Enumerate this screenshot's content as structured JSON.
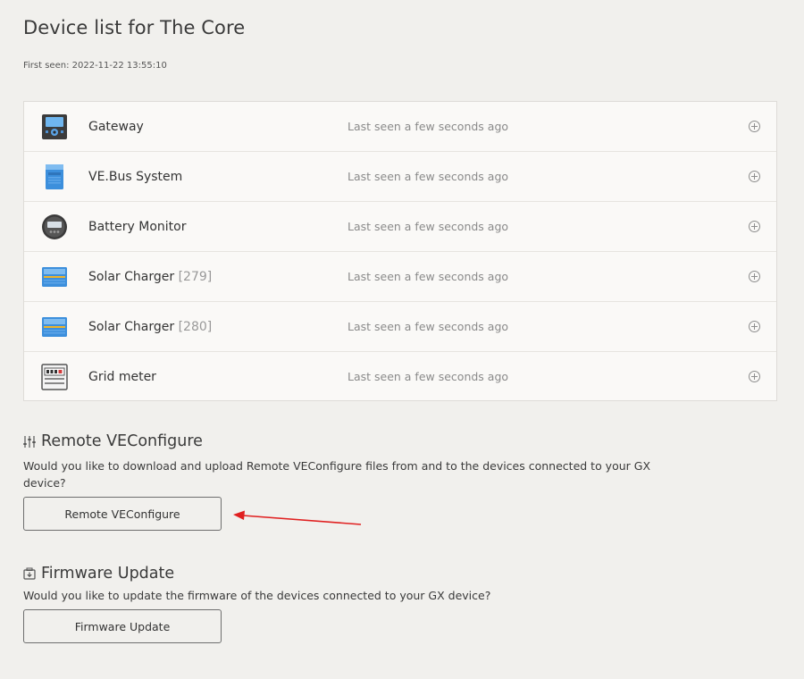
{
  "page": {
    "title": "Device list for The Core",
    "first_seen": "First seen: 2022-11-22 13:55:10"
  },
  "devices": [
    {
      "name": "Gateway",
      "id": "",
      "status": "Last seen a few seconds ago",
      "icon": "gateway-icon"
    },
    {
      "name": "VE.Bus System",
      "id": "",
      "status": "Last seen a few seconds ago",
      "icon": "inverter-icon"
    },
    {
      "name": "Battery Monitor",
      "id": "",
      "status": "Last seen a few seconds ago",
      "icon": "battery-monitor-icon"
    },
    {
      "name": "Solar Charger",
      "id": "[279]",
      "status": "Last seen a few seconds ago",
      "icon": "solar-charger-icon"
    },
    {
      "name": "Solar Charger",
      "id": "[280]",
      "status": "Last seen a few seconds ago",
      "icon": "solar-charger-icon"
    },
    {
      "name": "Grid meter",
      "id": "",
      "status": "Last seen a few seconds ago",
      "icon": "grid-meter-icon"
    }
  ],
  "remote_veconfigure": {
    "title": "Remote VEConfigure",
    "description": "Would you like to download and upload Remote VEConfigure files from and to the devices connected to your GX device?",
    "button_label": "Remote VEConfigure",
    "icon": "sliders-icon"
  },
  "firmware_update": {
    "title": "Firmware Update",
    "description": "Would you like to update the firmware of the devices connected to your GX device?",
    "button_label": "Firmware Update",
    "icon": "firmware-icon"
  },
  "colors": {
    "background": "#f1f0ed",
    "panel": "#faf9f7",
    "device_blue": "#3c8fdc",
    "annotation_red": "#e02020"
  }
}
